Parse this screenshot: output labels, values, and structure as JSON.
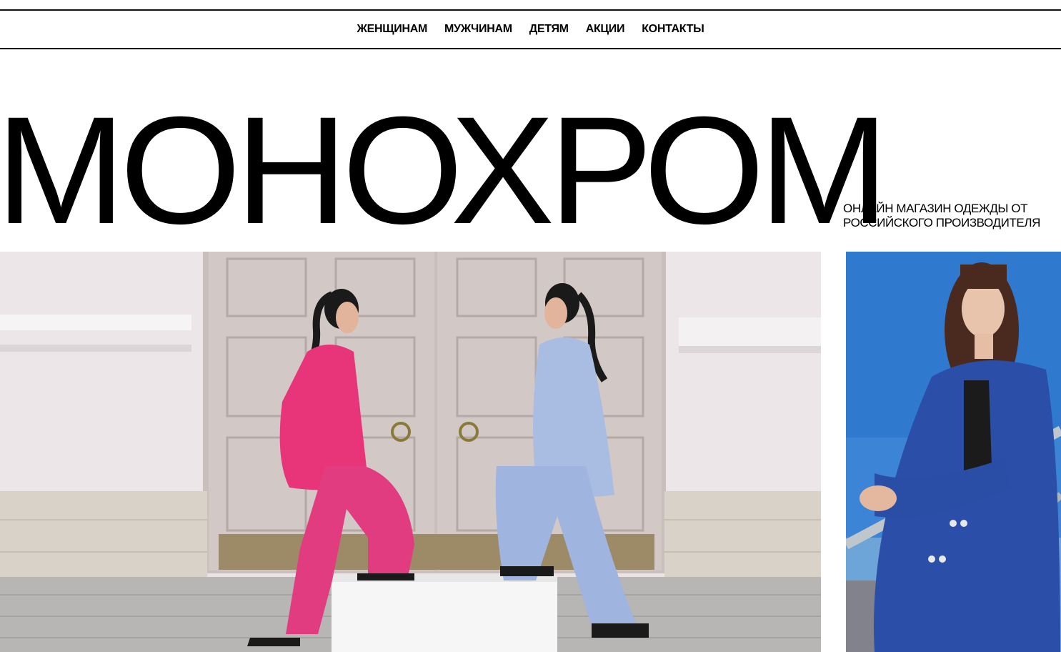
{
  "nav": {
    "items": [
      "ЖЕНЩИНАМ",
      "МУЖЧИНАМ",
      "ДЕТЯМ",
      "АКЦИИ",
      "КОНТАКТЫ"
    ]
  },
  "brand": {
    "name": "МОНОХРОМ",
    "tagline_line1": "ОНЛАЙН МАГАЗИН ОДЕЖДЫ ОТ",
    "tagline_line2": "РОССИЙСКОГО ПРОИЗВОДИТЕЛЯ"
  },
  "colors": {
    "border": "#111111",
    "text": "#000000",
    "pink_suit": "#e8357a",
    "blue_suit": "#a9bde3",
    "cobalt_jacket": "#2b4fa8"
  }
}
